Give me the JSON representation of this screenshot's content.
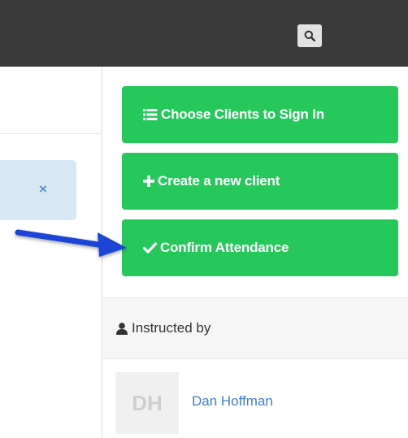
{
  "topbar": {
    "search_icon": "search-icon"
  },
  "left_panel": {
    "chip_close": "×"
  },
  "actions": [
    {
      "label": "Choose Clients to Sign In",
      "icon": "list-icon"
    },
    {
      "label": "Create a new client",
      "icon": "plus-icon"
    },
    {
      "label": "Confirm Attendance",
      "icon": "check-icon"
    }
  ],
  "instructed": {
    "label": "Instructed by",
    "icon": "user-icon"
  },
  "instructor": {
    "initials": "DH",
    "name": "Dan Hoffman"
  },
  "colors": {
    "topbar": "#3a3a3a",
    "button_green": "#26c85c",
    "chip_blue": "#d7e7f3",
    "link_blue": "#3f7fcf",
    "arrow_blue": "#1a45d6"
  }
}
